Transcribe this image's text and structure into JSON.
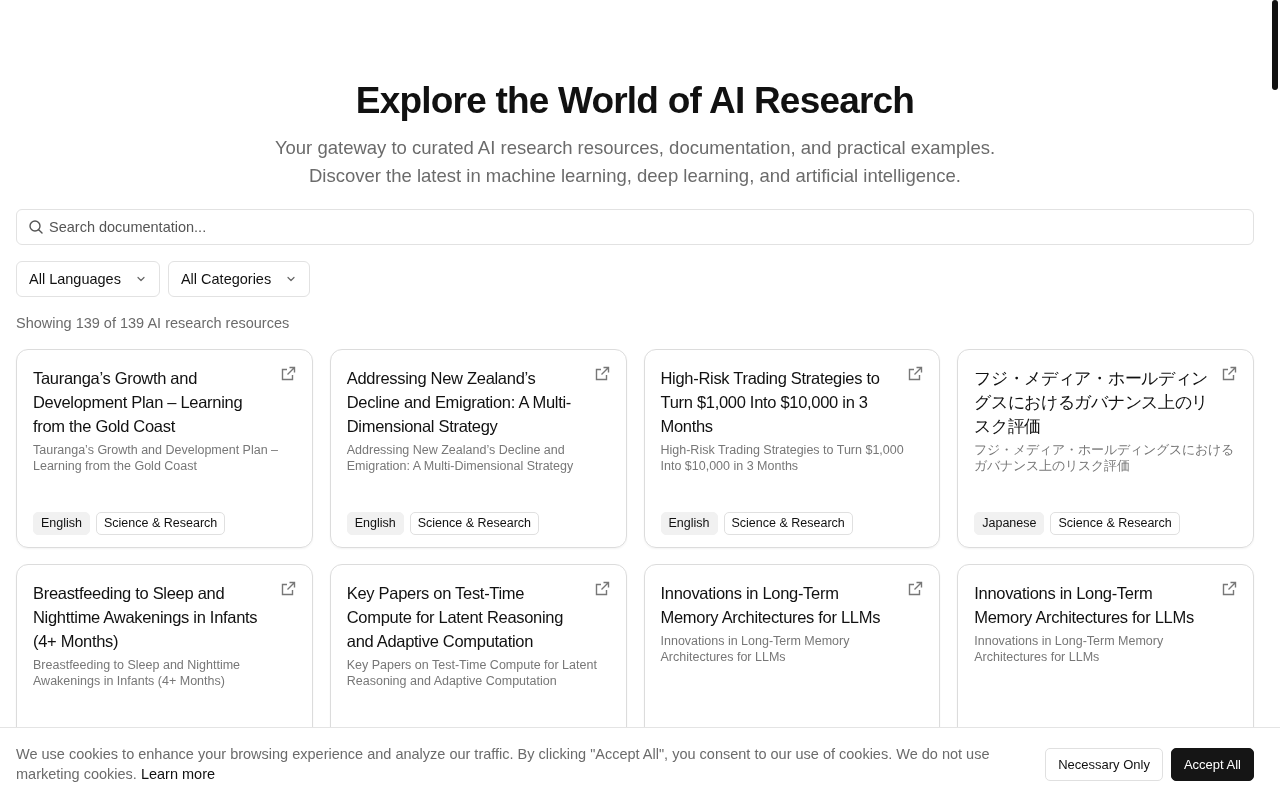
{
  "header": {
    "title": "Explore the World of AI Research",
    "subtitle_lines": [
      "Your gateway to curated AI research resources, documentation, and practical examples.",
      "Discover the latest in machine learning, deep learning, and artificial intelligence."
    ]
  },
  "search": {
    "placeholder": "Search documentation..."
  },
  "filters": [
    {
      "label": "All Languages"
    },
    {
      "label": "All Categories"
    }
  ],
  "result_count": "Showing 139 of 139 AI research resources",
  "cards": [
    {
      "title": "Tauranga’s Growth and Development Plan – Learning from the Gold Coast",
      "description": "Tauranga’s Growth and Development Plan – Learning from the Gold Coast",
      "tags": [
        {
          "kind": "language",
          "label": "English"
        },
        {
          "kind": "category",
          "label": "Science & Research"
        }
      ]
    },
    {
      "title": "Addressing New Zealand’s Decline and Emigration: A Multi-Dimensional Strategy",
      "description": "Addressing New Zealand’s Decline and Emigration: A Multi-Dimensional Strategy",
      "tags": [
        {
          "kind": "language",
          "label": "English"
        },
        {
          "kind": "category",
          "label": "Science & Research"
        }
      ]
    },
    {
      "title": "High-Risk Trading Strategies to Turn $1,000 Into $10,000 in 3 Months",
      "description": "High-Risk Trading Strategies to Turn $1,000 Into $10,000 in 3 Months",
      "tags": [
        {
          "kind": "language",
          "label": "English"
        },
        {
          "kind": "category",
          "label": "Science & Research"
        }
      ]
    },
    {
      "title": "フジ・メディア・ホールディングスにおけるガバナンス上のリスク評価",
      "description": "フジ・メディア・ホールディングスにおけるガバナンス上のリスク評価",
      "tags": [
        {
          "kind": "language",
          "label": "Japanese"
        },
        {
          "kind": "category",
          "label": "Science & Research"
        }
      ]
    },
    {
      "title": "Breastfeeding to Sleep and Nighttime Awakenings in Infants (4+ Months)",
      "description": "Breastfeeding to Sleep and Nighttime Awakenings in Infants (4+ Months)"
    },
    {
      "title": "Key Papers on Test-Time Compute for Latent Reasoning and Adaptive Computation",
      "description": "Key Papers on Test-Time Compute for Latent Reasoning and Adaptive Computation"
    },
    {
      "title": "Innovations in Long-Term Memory Architectures for LLMs",
      "description": "Innovations in Long-Term Memory Architectures for LLMs"
    },
    {
      "title": "Innovations in Long-Term Memory Architectures for LLMs",
      "description": "Innovations in Long-Term Memory Architectures for LLMs"
    }
  ],
  "cookie_banner": {
    "text": "We use cookies to enhance your browsing experience and analyze our traffic. By clicking \"Accept All\", you consent to our use of cookies. We do not use marketing cookies.",
    "link": "Learn more",
    "buttons": [
      {
        "kind": "secondary",
        "label": "Necessary Only"
      },
      {
        "kind": "primary",
        "label": "Accept All"
      }
    ]
  }
}
